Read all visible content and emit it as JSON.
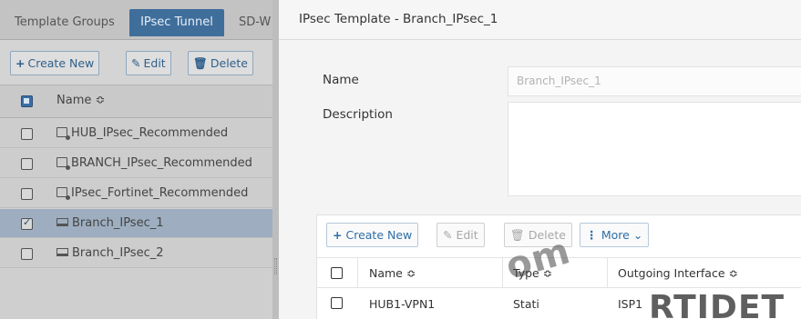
{
  "left_panel": {
    "tabs": [
      "Template Groups",
      "IPsec Tunnel",
      "SD-W"
    ],
    "toolbar": {
      "create_new": "Create New",
      "edit": "Edit",
      "delete": "Delete"
    },
    "name_column": "Name ≎",
    "rows": [
      "HUB_IPsec_Recommended",
      "BRANCH_IPsec_Recommended",
      "IPsec_Fortinet_Recommended",
      "Branch_IPsec_1",
      "Branch_IPsec_2"
    ]
  },
  "modal": {
    "title": "IPsec Template - Branch_IPsec_1",
    "name_label": "Name",
    "name_value": "Branch_IPsec_1",
    "description_label": "Description",
    "toolbar": {
      "create_new": "Create New",
      "edit": "Edit",
      "delete": "Delete",
      "more": "More"
    },
    "columns": {
      "name": "Name ≎",
      "type": "Type ≎",
      "outgoing_interface": "Outgoing Interface ≎"
    },
    "rows": [
      {
        "name": "HUB1-VPN1",
        "type": "Stati",
        "interface": "ISP1"
      }
    ]
  },
  "watermark": {
    "left": "om",
    "right": "RTIDET"
  }
}
